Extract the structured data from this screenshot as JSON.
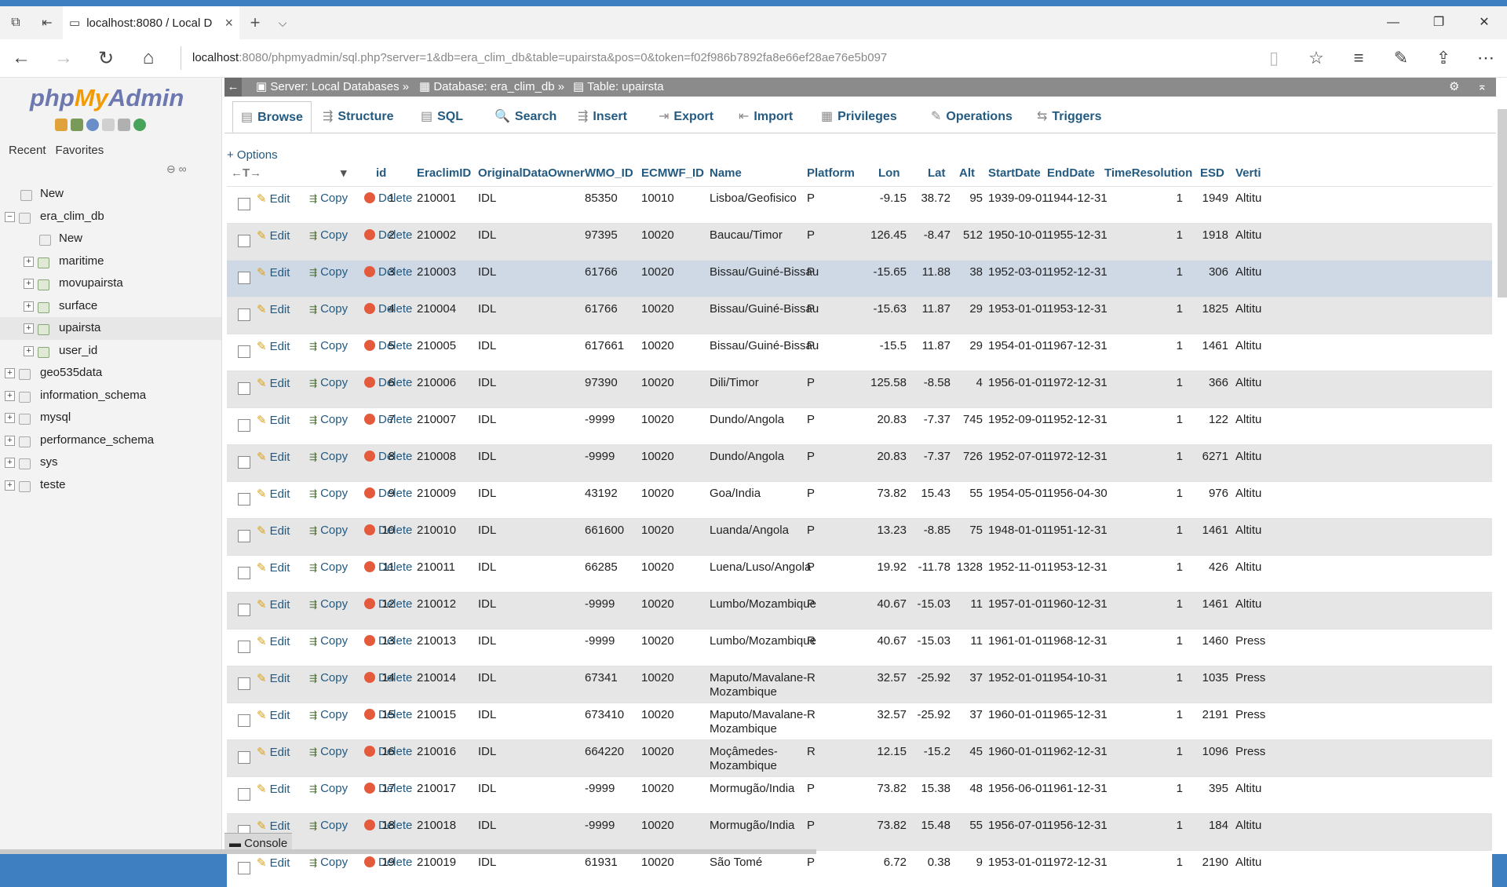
{
  "browser": {
    "tab_title": "localhost:8080 / Local D",
    "url_host": "localhost",
    "url_rest": ":8080/phpmyadmin/sql.php?server=1&db=era_clim_db&table=upairsta&pos=0&token=f02f986b7892fa8e66ef28ae76e5b097"
  },
  "left": {
    "logo": {
      "php": "php",
      "my": "My",
      "admin": "Admin"
    },
    "recent": "Recent",
    "favorites": "Favorites",
    "tree": [
      {
        "label": "New",
        "level": 0,
        "type": "new"
      },
      {
        "label": "era_clim_db",
        "level": 0,
        "type": "db",
        "expanded": true
      },
      {
        "label": "New",
        "level": 1,
        "type": "new"
      },
      {
        "label": "maritime",
        "level": 1,
        "type": "table"
      },
      {
        "label": "movupairsta",
        "level": 1,
        "type": "table"
      },
      {
        "label": "surface",
        "level": 1,
        "type": "table"
      },
      {
        "label": "upairsta",
        "level": 1,
        "type": "table",
        "selected": true
      },
      {
        "label": "user_id",
        "level": 1,
        "type": "table"
      },
      {
        "label": "geo535data",
        "level": 0,
        "type": "db"
      },
      {
        "label": "information_schema",
        "level": 0,
        "type": "db"
      },
      {
        "label": "mysql",
        "level": 0,
        "type": "db"
      },
      {
        "label": "performance_schema",
        "level": 0,
        "type": "db"
      },
      {
        "label": "sys",
        "level": 0,
        "type": "db"
      },
      {
        "label": "teste",
        "level": 0,
        "type": "db"
      }
    ]
  },
  "breadcrumb": {
    "server": "Server: Local Databases",
    "database": "Database: era_clim_db",
    "table": "Table: upairsta"
  },
  "tabs": [
    "Browse",
    "Structure",
    "SQL",
    "Search",
    "Insert",
    "Export",
    "Import",
    "Privileges",
    "Operations",
    "Triggers"
  ],
  "options_label": "+ Options",
  "actions": {
    "edit": "Edit",
    "copy": "Copy",
    "delete": "Delete"
  },
  "columns": [
    "id",
    "EraclimID",
    "OriginalDataOwner",
    "WMO_ID",
    "ECMWF_ID",
    "Name",
    "Platform",
    "Lon",
    "Lat",
    "Alt",
    "StartDate",
    "EndDate",
    "TimeResolution",
    "ESD",
    "Verti"
  ],
  "rows": [
    [
      "1",
      "210001",
      "IDL",
      "85350",
      "10010",
      "Lisboa/Geofisico",
      "P",
      "-9.15",
      "38.72",
      "95",
      "1939-09-01",
      "1944-12-31",
      "1",
      "1949",
      "Altitu"
    ],
    [
      "2",
      "210002",
      "IDL",
      "97395",
      "10020",
      "Baucau/Timor",
      "P",
      "126.45",
      "-8.47",
      "512",
      "1950-10-01",
      "1955-12-31",
      "1",
      "1918",
      "Altitu"
    ],
    [
      "3",
      "210003",
      "IDL",
      "61766",
      "10020",
      "Bissau/Guiné-Bissau",
      "P",
      "-15.65",
      "11.88",
      "38",
      "1952-03-01",
      "1952-12-31",
      "1",
      "306",
      "Altitu"
    ],
    [
      "4",
      "210004",
      "IDL",
      "61766",
      "10020",
      "Bissau/Guiné-Bissau",
      "P",
      "-15.63",
      "11.87",
      "29",
      "1953-01-01",
      "1953-12-31",
      "1",
      "1825",
      "Altitu"
    ],
    [
      "5",
      "210005",
      "IDL",
      "617661",
      "10020",
      "Bissau/Guiné-Bissau",
      "P",
      "-15.5",
      "11.87",
      "29",
      "1954-01-01",
      "1967-12-31",
      "1",
      "1461",
      "Altitu"
    ],
    [
      "6",
      "210006",
      "IDL",
      "97390",
      "10020",
      "Dili/Timor",
      "P",
      "125.58",
      "-8.58",
      "4",
      "1956-01-01",
      "1972-12-31",
      "1",
      "366",
      "Altitu"
    ],
    [
      "7",
      "210007",
      "IDL",
      "-9999",
      "10020",
      "Dundo/Angola",
      "P",
      "20.83",
      "-7.37",
      "745",
      "1952-09-01",
      "1952-12-31",
      "1",
      "122",
      "Altitu"
    ],
    [
      "8",
      "210008",
      "IDL",
      "-9999",
      "10020",
      "Dundo/Angola",
      "P",
      "20.83",
      "-7.37",
      "726",
      "1952-07-01",
      "1972-12-31",
      "1",
      "6271",
      "Altitu"
    ],
    [
      "9",
      "210009",
      "IDL",
      "43192",
      "10020",
      "Goa/India",
      "P",
      "73.82",
      "15.43",
      "55",
      "1954-05-01",
      "1956-04-30",
      "1",
      "976",
      "Altitu"
    ],
    [
      "10",
      "210010",
      "IDL",
      "661600",
      "10020",
      "Luanda/Angola",
      "P",
      "13.23",
      "-8.85",
      "75",
      "1948-01-01",
      "1951-12-31",
      "1",
      "1461",
      "Altitu"
    ],
    [
      "11",
      "210011",
      "IDL",
      "66285",
      "10020",
      "Luena/Luso/Angola",
      "P",
      "19.92",
      "-11.78",
      "1328",
      "1952-11-01",
      "1953-12-31",
      "1",
      "426",
      "Altitu"
    ],
    [
      "12",
      "210012",
      "IDL",
      "-9999",
      "10020",
      "Lumbo/Mozambique",
      "P",
      "40.67",
      "-15.03",
      "11",
      "1957-01-01",
      "1960-12-31",
      "1",
      "1461",
      "Altitu"
    ],
    [
      "13",
      "210013",
      "IDL",
      "-9999",
      "10020",
      "Lumbo/Mozambique",
      "R",
      "40.67",
      "-15.03",
      "11",
      "1961-01-01",
      "1968-12-31",
      "1",
      "1460",
      "Press"
    ],
    [
      "14",
      "210014",
      "IDL",
      "67341",
      "10020",
      "Maputo/Mavalane-Mozambique",
      "R",
      "32.57",
      "-25.92",
      "37",
      "1952-01-01",
      "1954-10-31",
      "1",
      "1035",
      "Press"
    ],
    [
      "15",
      "210015",
      "IDL",
      "673410",
      "10020",
      "Maputo/Mavalane-Mozambique",
      "R",
      "32.57",
      "-25.92",
      "37",
      "1960-01-01",
      "1965-12-31",
      "1",
      "2191",
      "Press"
    ],
    [
      "16",
      "210016",
      "IDL",
      "664220",
      "10020",
      "Moçâmedes-Mozambique",
      "R",
      "12.15",
      "-15.2",
      "45",
      "1960-01-01",
      "1962-12-31",
      "1",
      "1096",
      "Press"
    ],
    [
      "17",
      "210017",
      "IDL",
      "-9999",
      "10020",
      "Mormugão/India",
      "P",
      "73.82",
      "15.38",
      "48",
      "1956-06-01",
      "1961-12-31",
      "1",
      "395",
      "Altitu"
    ],
    [
      "18",
      "210018",
      "IDL",
      "-9999",
      "10020",
      "Mormugão/India",
      "P",
      "73.82",
      "15.48",
      "55",
      "1956-07-01",
      "1956-12-31",
      "1",
      "184",
      "Altitu"
    ],
    [
      "19",
      "210019",
      "IDL",
      "61931",
      "10020",
      "São Tomé",
      "P",
      "6.72",
      "0.38",
      "9",
      "1953-01-01",
      "1972-12-31",
      "1",
      "2190",
      "Altitu"
    ]
  ],
  "console_label": "Console"
}
